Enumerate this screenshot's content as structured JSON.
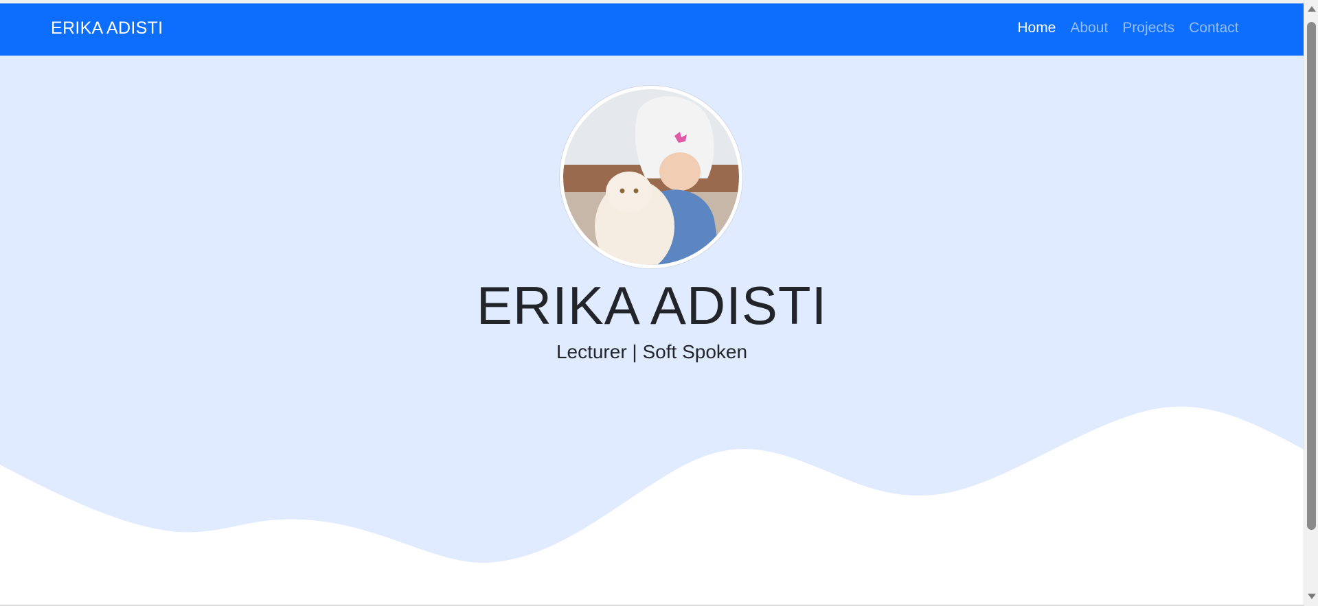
{
  "navbar": {
    "brand": "ERIKA ADISTI",
    "links": [
      {
        "label": "Home",
        "active": true
      },
      {
        "label": "About",
        "active": false
      },
      {
        "label": "Projects",
        "active": false
      },
      {
        "label": "Contact",
        "active": false
      }
    ]
  },
  "hero": {
    "avatar_icon": "profile-photo-icon",
    "name": "ERIKA ADISTI",
    "tagline": "Lecturer | Soft Spoken"
  },
  "colors": {
    "navbar_bg": "#0d6efd",
    "hero_bg": "#e0ebff",
    "wave_fill": "#ffffff",
    "text": "#212529"
  }
}
